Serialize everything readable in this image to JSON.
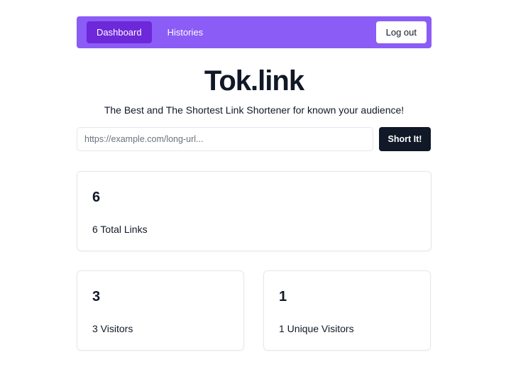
{
  "nav": {
    "tabs": [
      {
        "label": "Dashboard",
        "active": true
      },
      {
        "label": "Histories",
        "active": false
      }
    ],
    "logout_label": "Log out"
  },
  "hero": {
    "title": "Tok.link",
    "subtitle": "The Best and The Shortest Link Shortener for known your audience!"
  },
  "shortener": {
    "placeholder": "https://example.com/long-url...",
    "value": "",
    "button_label": "Short It!"
  },
  "stats": {
    "total_links": {
      "value": "6",
      "label": "6 Total Links"
    },
    "visitors": {
      "value": "3",
      "label": "3 Visitors"
    },
    "unique_visitors": {
      "value": "1",
      "label": "1 Unique Visitors"
    }
  },
  "colors": {
    "nav_background": "#8b5cf6",
    "nav_active_tab": "#6d28d9",
    "primary_button": "#111827",
    "card_border": "#e5e7eb"
  }
}
